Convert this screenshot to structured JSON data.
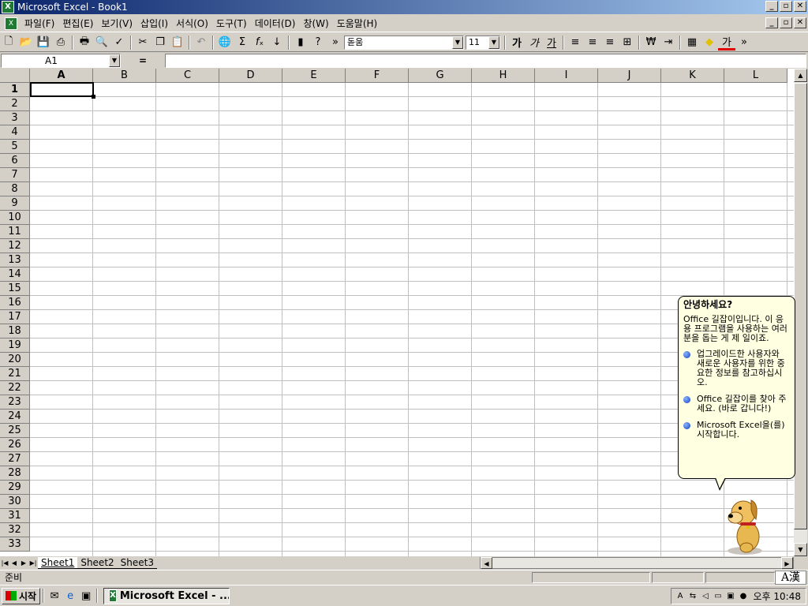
{
  "window": {
    "title": "Microsoft Excel - Book1"
  },
  "menu": [
    "파일(F)",
    "편집(E)",
    "보기(V)",
    "삽입(I)",
    "서식(O)",
    "도구(T)",
    "데이터(D)",
    "창(W)",
    "도움말(H)"
  ],
  "toolbar": {
    "font_name": "돋움",
    "font_size": "11",
    "bold": "가",
    "italic": "가",
    "underline": "가",
    "font_color_letter": "가"
  },
  "formula": {
    "name_box": "A1",
    "equals": "="
  },
  "columns": [
    "A",
    "B",
    "C",
    "D",
    "E",
    "F",
    "G",
    "H",
    "I",
    "J",
    "K",
    "L"
  ],
  "rows": [
    "1",
    "2",
    "3",
    "4",
    "5",
    "6",
    "7",
    "8",
    "9",
    "10",
    "11",
    "12",
    "13",
    "14",
    "15",
    "16",
    "17",
    "18",
    "19",
    "20",
    "21",
    "22",
    "23",
    "24",
    "25",
    "26",
    "27",
    "28",
    "29",
    "30",
    "31",
    "32",
    "33"
  ],
  "sheets": [
    "Sheet1",
    "Sheet2",
    "Sheet3"
  ],
  "status": {
    "text": "준비",
    "ime": "A漢"
  },
  "assistant": {
    "title": "안녕하세요?",
    "body": "Office 길잡이입니다. 이 응용 프로그램을 사용하는 여러분을 돕는 게 제 일이죠.",
    "options": [
      "업그레이드한 사용자와 새로운 사용자를 위한 중요한 정보를 참고하십시오.",
      "Office 길잡이를 찾아 주세요. (바로 갑니다!)",
      "Microsoft Excel을(를) 시작합니다."
    ]
  },
  "taskbar": {
    "start": "시작",
    "task": "Microsoft Excel - ...",
    "clock": "오후 10:48"
  },
  "colors": {
    "title_start": "#0a246a",
    "title_end": "#a6caf0",
    "balloon": "#ffffe1",
    "excel_green": "#1f7a33"
  }
}
